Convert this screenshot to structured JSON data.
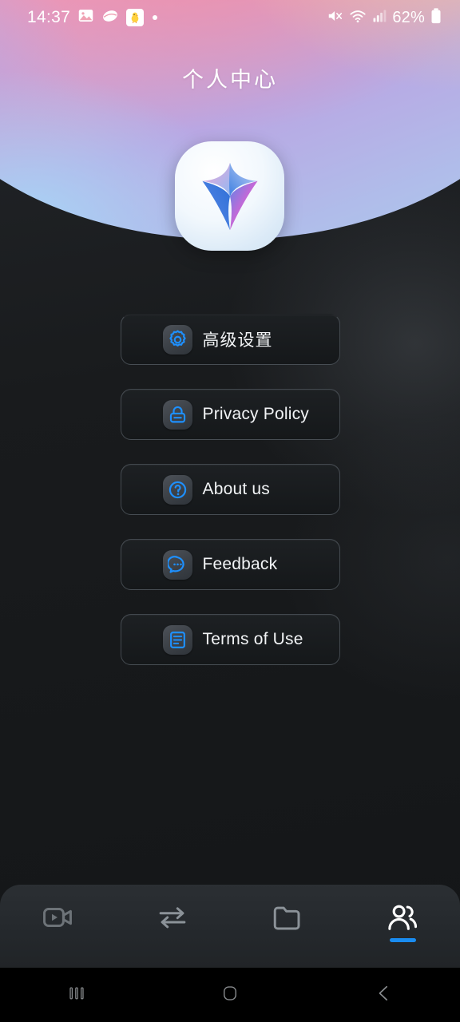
{
  "status_bar": {
    "time": "14:37",
    "battery_percent": "62%",
    "left_icons": [
      {
        "name": "photo-icon",
        "glyph": "❑"
      },
      {
        "name": "shell-icon",
        "glyph": "◑"
      },
      {
        "name": "chick-emoji-icon",
        "glyph": "🐥"
      },
      {
        "name": "notification-dot-icon",
        "glyph": ""
      }
    ],
    "right_icons": [
      {
        "name": "mute-icon"
      },
      {
        "name": "wifi-icon"
      },
      {
        "name": "cellular-signal-icon"
      },
      {
        "name": "battery-icon"
      }
    ]
  },
  "header": {
    "title": "个人中心",
    "logo_name": "app-sparkle-logo"
  },
  "menu": {
    "items": [
      {
        "label": "高级设置",
        "icon": "gear-icon",
        "cjk": true
      },
      {
        "label": "Privacy Policy",
        "icon": "lock-icon",
        "cjk": false
      },
      {
        "label": "About us",
        "icon": "question-icon",
        "cjk": false
      },
      {
        "label": "Feedback",
        "icon": "chat-icon",
        "cjk": false
      },
      {
        "label": "Terms of Use",
        "icon": "document-icon",
        "cjk": false
      }
    ]
  },
  "tabbar": {
    "active_index": 3,
    "accent_color": "#1a8cf0",
    "items": [
      {
        "name": "tab-video",
        "icon": "video-camera-icon",
        "active": false
      },
      {
        "name": "tab-transfer",
        "icon": "transfer-arrows-icon",
        "active": false
      },
      {
        "name": "tab-files",
        "icon": "folder-icon",
        "active": false
      },
      {
        "name": "tab-profile",
        "icon": "users-icon",
        "active": true
      }
    ]
  },
  "system_nav": {
    "items": [
      {
        "name": "recents-button",
        "icon": "recents-icon"
      },
      {
        "name": "home-button",
        "icon": "home-icon"
      },
      {
        "name": "back-button",
        "icon": "back-chevron-icon"
      }
    ]
  },
  "theme": {
    "accent": "#1a8cf0",
    "icon_blue": "#1e90ff",
    "background": "#191b1d",
    "card_bg": "#1a1d20",
    "text": "#f2f4f6"
  }
}
